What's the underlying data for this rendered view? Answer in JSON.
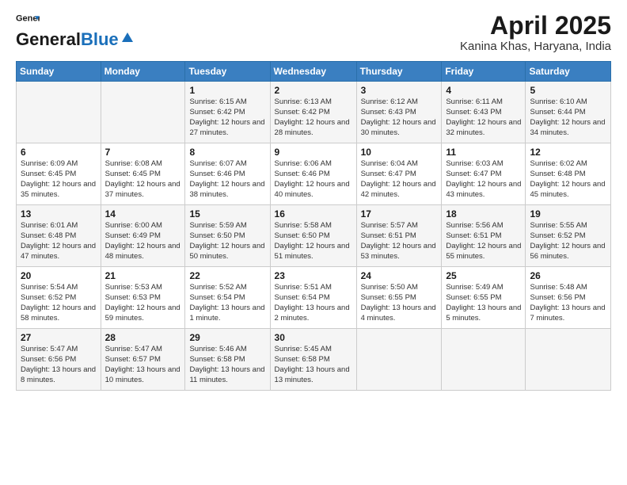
{
  "header": {
    "logo_general": "General",
    "logo_blue": "Blue",
    "month_title": "April 2025",
    "location": "Kanina Khas, Haryana, India"
  },
  "days_of_week": [
    "Sunday",
    "Monday",
    "Tuesday",
    "Wednesday",
    "Thursday",
    "Friday",
    "Saturday"
  ],
  "weeks": [
    [
      {
        "day": "",
        "sunrise": "",
        "sunset": "",
        "daylight": ""
      },
      {
        "day": "",
        "sunrise": "",
        "sunset": "",
        "daylight": ""
      },
      {
        "day": "1",
        "sunrise": "Sunrise: 6:15 AM",
        "sunset": "Sunset: 6:42 PM",
        "daylight": "Daylight: 12 hours and 27 minutes."
      },
      {
        "day": "2",
        "sunrise": "Sunrise: 6:13 AM",
        "sunset": "Sunset: 6:42 PM",
        "daylight": "Daylight: 12 hours and 28 minutes."
      },
      {
        "day": "3",
        "sunrise": "Sunrise: 6:12 AM",
        "sunset": "Sunset: 6:43 PM",
        "daylight": "Daylight: 12 hours and 30 minutes."
      },
      {
        "day": "4",
        "sunrise": "Sunrise: 6:11 AM",
        "sunset": "Sunset: 6:43 PM",
        "daylight": "Daylight: 12 hours and 32 minutes."
      },
      {
        "day": "5",
        "sunrise": "Sunrise: 6:10 AM",
        "sunset": "Sunset: 6:44 PM",
        "daylight": "Daylight: 12 hours and 34 minutes."
      }
    ],
    [
      {
        "day": "6",
        "sunrise": "Sunrise: 6:09 AM",
        "sunset": "Sunset: 6:45 PM",
        "daylight": "Daylight: 12 hours and 35 minutes."
      },
      {
        "day": "7",
        "sunrise": "Sunrise: 6:08 AM",
        "sunset": "Sunset: 6:45 PM",
        "daylight": "Daylight: 12 hours and 37 minutes."
      },
      {
        "day": "8",
        "sunrise": "Sunrise: 6:07 AM",
        "sunset": "Sunset: 6:46 PM",
        "daylight": "Daylight: 12 hours and 38 minutes."
      },
      {
        "day": "9",
        "sunrise": "Sunrise: 6:06 AM",
        "sunset": "Sunset: 6:46 PM",
        "daylight": "Daylight: 12 hours and 40 minutes."
      },
      {
        "day": "10",
        "sunrise": "Sunrise: 6:04 AM",
        "sunset": "Sunset: 6:47 PM",
        "daylight": "Daylight: 12 hours and 42 minutes."
      },
      {
        "day": "11",
        "sunrise": "Sunrise: 6:03 AM",
        "sunset": "Sunset: 6:47 PM",
        "daylight": "Daylight: 12 hours and 43 minutes."
      },
      {
        "day": "12",
        "sunrise": "Sunrise: 6:02 AM",
        "sunset": "Sunset: 6:48 PM",
        "daylight": "Daylight: 12 hours and 45 minutes."
      }
    ],
    [
      {
        "day": "13",
        "sunrise": "Sunrise: 6:01 AM",
        "sunset": "Sunset: 6:48 PM",
        "daylight": "Daylight: 12 hours and 47 minutes."
      },
      {
        "day": "14",
        "sunrise": "Sunrise: 6:00 AM",
        "sunset": "Sunset: 6:49 PM",
        "daylight": "Daylight: 12 hours and 48 minutes."
      },
      {
        "day": "15",
        "sunrise": "Sunrise: 5:59 AM",
        "sunset": "Sunset: 6:50 PM",
        "daylight": "Daylight: 12 hours and 50 minutes."
      },
      {
        "day": "16",
        "sunrise": "Sunrise: 5:58 AM",
        "sunset": "Sunset: 6:50 PM",
        "daylight": "Daylight: 12 hours and 51 minutes."
      },
      {
        "day": "17",
        "sunrise": "Sunrise: 5:57 AM",
        "sunset": "Sunset: 6:51 PM",
        "daylight": "Daylight: 12 hours and 53 minutes."
      },
      {
        "day": "18",
        "sunrise": "Sunrise: 5:56 AM",
        "sunset": "Sunset: 6:51 PM",
        "daylight": "Daylight: 12 hours and 55 minutes."
      },
      {
        "day": "19",
        "sunrise": "Sunrise: 5:55 AM",
        "sunset": "Sunset: 6:52 PM",
        "daylight": "Daylight: 12 hours and 56 minutes."
      }
    ],
    [
      {
        "day": "20",
        "sunrise": "Sunrise: 5:54 AM",
        "sunset": "Sunset: 6:52 PM",
        "daylight": "Daylight: 12 hours and 58 minutes."
      },
      {
        "day": "21",
        "sunrise": "Sunrise: 5:53 AM",
        "sunset": "Sunset: 6:53 PM",
        "daylight": "Daylight: 12 hours and 59 minutes."
      },
      {
        "day": "22",
        "sunrise": "Sunrise: 5:52 AM",
        "sunset": "Sunset: 6:54 PM",
        "daylight": "Daylight: 13 hours and 1 minute."
      },
      {
        "day": "23",
        "sunrise": "Sunrise: 5:51 AM",
        "sunset": "Sunset: 6:54 PM",
        "daylight": "Daylight: 13 hours and 2 minutes."
      },
      {
        "day": "24",
        "sunrise": "Sunrise: 5:50 AM",
        "sunset": "Sunset: 6:55 PM",
        "daylight": "Daylight: 13 hours and 4 minutes."
      },
      {
        "day": "25",
        "sunrise": "Sunrise: 5:49 AM",
        "sunset": "Sunset: 6:55 PM",
        "daylight": "Daylight: 13 hours and 5 minutes."
      },
      {
        "day": "26",
        "sunrise": "Sunrise: 5:48 AM",
        "sunset": "Sunset: 6:56 PM",
        "daylight": "Daylight: 13 hours and 7 minutes."
      }
    ],
    [
      {
        "day": "27",
        "sunrise": "Sunrise: 5:47 AM",
        "sunset": "Sunset: 6:56 PM",
        "daylight": "Daylight: 13 hours and 8 minutes."
      },
      {
        "day": "28",
        "sunrise": "Sunrise: 5:47 AM",
        "sunset": "Sunset: 6:57 PM",
        "daylight": "Daylight: 13 hours and 10 minutes."
      },
      {
        "day": "29",
        "sunrise": "Sunrise: 5:46 AM",
        "sunset": "Sunset: 6:58 PM",
        "daylight": "Daylight: 13 hours and 11 minutes."
      },
      {
        "day": "30",
        "sunrise": "Sunrise: 5:45 AM",
        "sunset": "Sunset: 6:58 PM",
        "daylight": "Daylight: 13 hours and 13 minutes."
      },
      {
        "day": "",
        "sunrise": "",
        "sunset": "",
        "daylight": ""
      },
      {
        "day": "",
        "sunrise": "",
        "sunset": "",
        "daylight": ""
      },
      {
        "day": "",
        "sunrise": "",
        "sunset": "",
        "daylight": ""
      }
    ]
  ]
}
